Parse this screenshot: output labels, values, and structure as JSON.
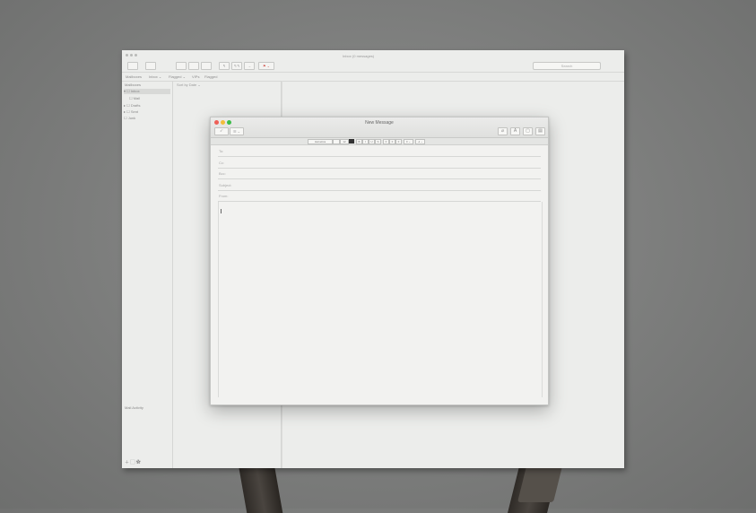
{
  "mail": {
    "window_title": "Inbox (0 messages)",
    "toolbar": {
      "reply": "↰",
      "reply_all": "↰↰",
      "forward": "→",
      "flag": "⚑ ⌄",
      "search_placeholder": "Search"
    },
    "favorites": [
      "Mailboxes",
      "Inbox ⌄",
      "Flagged ⌄",
      "VIPs",
      "Flagged"
    ],
    "sidebar": {
      "header": "Mailboxes",
      "items": [
        "▾ ☐ Inbox",
        "☐ Mail",
        "▸ ☐ Drafts",
        "▸ ☐ Sent",
        "☐ Junk"
      ],
      "bottom_label": "Mail Activity"
    },
    "list_sort": "Sort by Date ⌄"
  },
  "compose": {
    "title": "New Message",
    "send_icon": "paper-plane-icon",
    "header_button": "☰ ⌄",
    "right_buttons": [
      "⌀",
      "A",
      "▢",
      "▤"
    ],
    "format": {
      "font": "Helvetica",
      "size": "12",
      "styles": [
        "B",
        "I",
        "U",
        "S"
      ],
      "align": [
        "≡",
        "≡",
        "≡"
      ],
      "list": "≡ ⌄",
      "indent": "⇥ ⌄"
    },
    "fields": {
      "to": "To:",
      "cc": "Cc:",
      "bcc": "Bcc:",
      "subject": "Subject:",
      "from": "From:"
    }
  }
}
